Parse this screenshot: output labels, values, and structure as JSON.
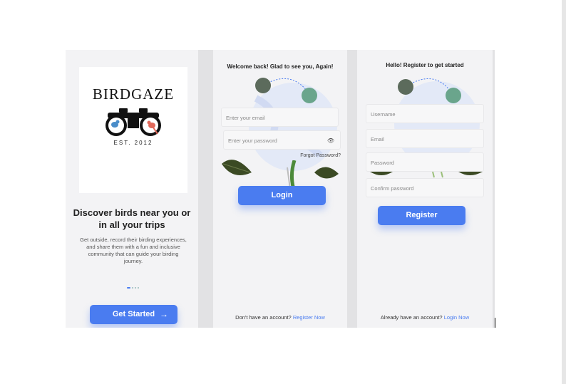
{
  "splash": {
    "brand": "BIRDGAZE",
    "est": "EST. 2012",
    "headline": "Discover birds near you or in all your trips",
    "description": "Get outside, record their birding experiences, and share them with a fun and inclusive community that can guide your birding journey.",
    "cta_label": "Get Started",
    "cta_icon": "arrow-right-icon"
  },
  "login": {
    "title": "Welcome back! Glad to see you, Again!",
    "email_placeholder": "Enter your email",
    "password_placeholder": "Enter your password",
    "forgot_label": "Forgot Password?",
    "submit_label": "Login",
    "footer_text": "Don't have an account?",
    "footer_link": "Register Now"
  },
  "register": {
    "title": "Hello! Register to get started",
    "username_placeholder": "Username",
    "email_placeholder": "Email",
    "password_placeholder": "Password",
    "confirm_placeholder": "Confirm password",
    "submit_label": "Register",
    "footer_text": "Already have an account?",
    "footer_link": "Login Now"
  },
  "colors": {
    "accent": "#4a7cf0",
    "screen_bg": "#f3f3f5",
    "leaf": "#3b4a24"
  }
}
